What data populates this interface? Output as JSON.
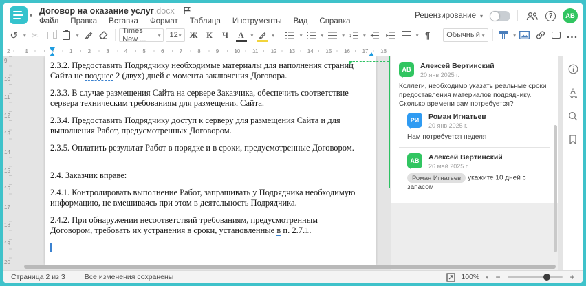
{
  "colors": {
    "accent_teal": "#3fc2ca",
    "comment_green": "#2ec163",
    "avatar_green": "#31c561",
    "avatar_blue": "#2f9bf2",
    "toolbar_blue": "#4a7ebb",
    "highlight_yellow": "#f2d43c"
  },
  "header": {
    "doc_title": "Договор на оказание услуг",
    "doc_ext": ".docx",
    "menu_items": [
      "Файл",
      "Правка",
      "Вставка",
      "Формат",
      "Таблица",
      "Инструменты",
      "Вид",
      "Справка"
    ],
    "review_label": "Рецензирование",
    "help_label": "?",
    "avatar_initials": "АВ"
  },
  "toolbar": {
    "font_name": "Times New ...",
    "font_size": "12",
    "bold": "Ж",
    "italic": "К",
    "underline": "Ч",
    "font_color": "А",
    "pilcrow": "¶",
    "style_name": "Обычный",
    "more": "..."
  },
  "ruler": {
    "left_numbers": [
      "2",
      "1"
    ],
    "numbers": [
      "1",
      "2",
      "3",
      "4",
      "5",
      "6",
      "7",
      "8",
      "9",
      "10",
      "11",
      "12",
      "13",
      "14",
      "15",
      "16",
      "17",
      "18"
    ],
    "vertical_numbers": [
      "9",
      "10",
      "11",
      "12",
      "13",
      "14",
      "15",
      "16",
      "17",
      "18",
      "19",
      "20"
    ]
  },
  "document": {
    "paragraphs": [
      {
        "segs": [
          {
            "t": "2.3.2. Предоставить Подрядчику необходимые материалы для наполнения страниц Сайта не "
          },
          {
            "t": "позднее",
            "u": true
          },
          {
            "t": " 2 (двух) дней с момента заключения Договора."
          }
        ]
      },
      {
        "segs": [
          {
            "t": "2.3.3. В случае размещения Сайта на сервере Заказчика, обеспечить соответствие сервера техническим требованиям для размещения Сайта."
          }
        ]
      },
      {
        "segs": [
          {
            "t": "2.3.4. Предоставить Подрядчику доступ к серверу для размещения Сайта и для выполнения Работ, предусмотренных Договором."
          }
        ]
      },
      {
        "segs": [
          {
            "t": "2.3.5. Оплатить результат Работ в порядке и в сроки, предусмотренные Договором."
          }
        ]
      },
      {
        "cls": "big-gap",
        "segs": [
          {
            "t": "2.4. Заказчик вправе:"
          }
        ]
      },
      {
        "segs": [
          {
            "t": "2.4.1. Контролировать выполнение Работ, запрашивать у Подрядчика необходимую информацию, не вмешиваясь при этом в деятельность Подрядчика."
          }
        ]
      },
      {
        "segs": [
          {
            "t": "2.4.2. При обнаружении несоответствий требованиям, предусмотренным Договором, требовать их устранения в сроки, установленные "
          },
          {
            "t": "в",
            "u": true
          },
          {
            "t": " п. 2.7.1."
          }
        ]
      }
    ]
  },
  "comments": {
    "thread": [
      {
        "initials": "АВ",
        "color": "#31c561",
        "name": "Алексей Вертинский",
        "date": "20 янв 2025 г.",
        "text": "Коллеги, необходимо указать реальные сроки предоставления материалов подрядчику. Сколько времени вам потребуется?",
        "reply": false
      },
      {
        "initials": "РИ",
        "color": "#2f9bf2",
        "name": "Роман Игнатьев",
        "date": "20 янв 2025 г.",
        "text": "Нам потребуется неделя",
        "reply": true
      },
      {
        "initials": "АВ",
        "color": "#31c561",
        "name": "Алексей Вертинский",
        "date": "26 май 2025 г.",
        "mention": "Роман Игнатьев",
        "text": "укажите 10 дней с запасом",
        "reply": true
      }
    ]
  },
  "statusbar": {
    "page_label": "Страница 2 из 3",
    "save_status": "Все изменения сохранены",
    "zoom_value": "100%",
    "zoom_out": "−",
    "zoom_in": "+"
  }
}
